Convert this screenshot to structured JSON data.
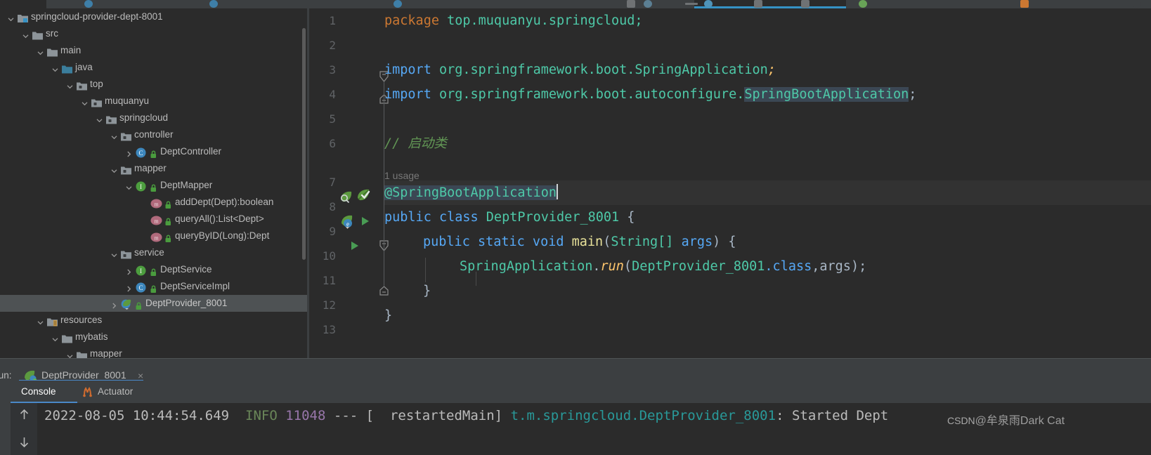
{
  "window": {
    "theme_bg": "#2b2b2b",
    "accent": "#3592c4"
  },
  "project_tree": {
    "name": "project-tool-window",
    "items": [
      {
        "label": "springcloud-provider-dept-8001",
        "depth": 0,
        "arrow": "down",
        "icon": "module-icon",
        "selected": false
      },
      {
        "label": "src",
        "depth": 1,
        "arrow": "down",
        "icon": "folder-icon",
        "selected": false
      },
      {
        "label": "main",
        "depth": 2,
        "arrow": "down",
        "icon": "folder-icon",
        "selected": false
      },
      {
        "label": "java",
        "depth": 3,
        "arrow": "down",
        "icon": "source-folder-icon",
        "selected": false
      },
      {
        "label": "top",
        "depth": 4,
        "arrow": "down",
        "icon": "package-icon",
        "selected": false
      },
      {
        "label": "muquanyu",
        "depth": 5,
        "arrow": "down",
        "icon": "package-icon",
        "selected": false
      },
      {
        "label": "springcloud",
        "depth": 6,
        "arrow": "down",
        "icon": "package-icon",
        "selected": false
      },
      {
        "label": "controller",
        "depth": 7,
        "arrow": "down",
        "icon": "package-icon",
        "selected": false
      },
      {
        "label": "DeptController",
        "depth": 8,
        "arrow": "right",
        "icon": "class-icon",
        "selected": false
      },
      {
        "label": "mapper",
        "depth": 7,
        "arrow": "down",
        "icon": "package-icon",
        "selected": false
      },
      {
        "label": "DeptMapper",
        "depth": 8,
        "arrow": "down",
        "icon": "interface-icon",
        "selected": false
      },
      {
        "label": "addDept(Dept):boolean",
        "depth": 9,
        "arrow": "none",
        "icon": "method-icon",
        "selected": false
      },
      {
        "label": "queryAll():List<Dept>",
        "depth": 9,
        "arrow": "none",
        "icon": "method-icon",
        "selected": false
      },
      {
        "label": "queryByID(Long):Dept",
        "depth": 9,
        "arrow": "none",
        "icon": "method-icon",
        "selected": false
      },
      {
        "label": "service",
        "depth": 7,
        "arrow": "down",
        "icon": "package-icon",
        "selected": false
      },
      {
        "label": "DeptService",
        "depth": 8,
        "arrow": "right",
        "icon": "interface-icon",
        "selected": false
      },
      {
        "label": "DeptServiceImpl",
        "depth": 8,
        "arrow": "right",
        "icon": "class-icon",
        "selected": false
      },
      {
        "label": "DeptProvider_8001",
        "depth": 7,
        "arrow": "right",
        "icon": "spring-class-icon",
        "selected": true
      },
      {
        "label": "resources",
        "depth": 2,
        "arrow": "down",
        "icon": "resources-folder-icon",
        "selected": false
      },
      {
        "label": "mybatis",
        "depth": 3,
        "arrow": "down",
        "icon": "folder-icon",
        "selected": false
      },
      {
        "label": "mapper",
        "depth": 4,
        "arrow": "down",
        "icon": "folder-icon",
        "selected": false
      }
    ]
  },
  "editor": {
    "name": "code-editor",
    "line_numbers": [
      "1",
      "2",
      "3",
      "4",
      "5",
      "6",
      "7",
      "8",
      "9",
      "10",
      "11",
      "12",
      "13"
    ],
    "usage_hint": "1 usage",
    "current_line": 7,
    "gutter_icons": {
      "line7_left": "spring-bean-search-icon",
      "line7_right": "spring-boot-check-icon",
      "line8_left": "spring-boot-run-icon",
      "line8_right": "run-play-icon",
      "line9": "run-play-icon"
    },
    "code": {
      "l1_kw": "package",
      "l1_pkg": " top.muquanyu.springcloud;",
      "l3_kw": "import",
      "l3_rest": " org.springframework.boot.",
      "l3_cls": "SpringApplication",
      "l3_semi": ";",
      "l4_kw": "import",
      "l4_rest": " org.springframework.boot.autoconfigure.",
      "l4_cls": "SpringBootApplication",
      "l4_semi": ";",
      "l6_comment": "// 启动类",
      "l7_annotation": "@SpringBootApplication",
      "l8_mod": "public class ",
      "l8_name": "DeptProvider_8001",
      "l8_brace": " {",
      "l9_mod": "public static void ",
      "l9_name": "main",
      "l9_p1": "(",
      "l9_type": "String",
      "l9_brk": "[] ",
      "l9_arg": "args",
      "l9_p2": ") {",
      "l10_cls": "SpringApplication",
      "l10_dot": ".",
      "l10_run": "run",
      "l10_p1": "(",
      "l10_ref": "DeptProvider_8001",
      "l10_dotclass": ".class",
      "l10_comma": ",",
      "l10_args": "args",
      "l10_end": ");",
      "l11_brace": "}",
      "l12_brace": "}"
    }
  },
  "run_panel": {
    "label": "Run:",
    "tab_title": "DeptProvider_8001",
    "tab_close": "×",
    "tab_icon": "spring-boot-running-icon",
    "subtabs": [
      {
        "label": "Console",
        "active": true,
        "icon": "none"
      },
      {
        "label": "Actuator",
        "active": false,
        "icon": "actuator-icon"
      }
    ],
    "toolbar_icons": [
      "scroll-up-icon",
      "scroll-down-icon",
      "rerun-icon",
      "chevron-down-icon"
    ],
    "console": {
      "timestamp": "2022-08-05 10:44:54.649",
      "level": "INFO",
      "pid": "11048",
      "separator": "---",
      "thread": "[  restartedMain]",
      "logger": "t.m.springcloud.DeptProvider_8001",
      "message": ": Started Dept"
    }
  },
  "watermark": {
    "prefix": "CSDN",
    "text": "@牟泉雨Dark Cat"
  }
}
